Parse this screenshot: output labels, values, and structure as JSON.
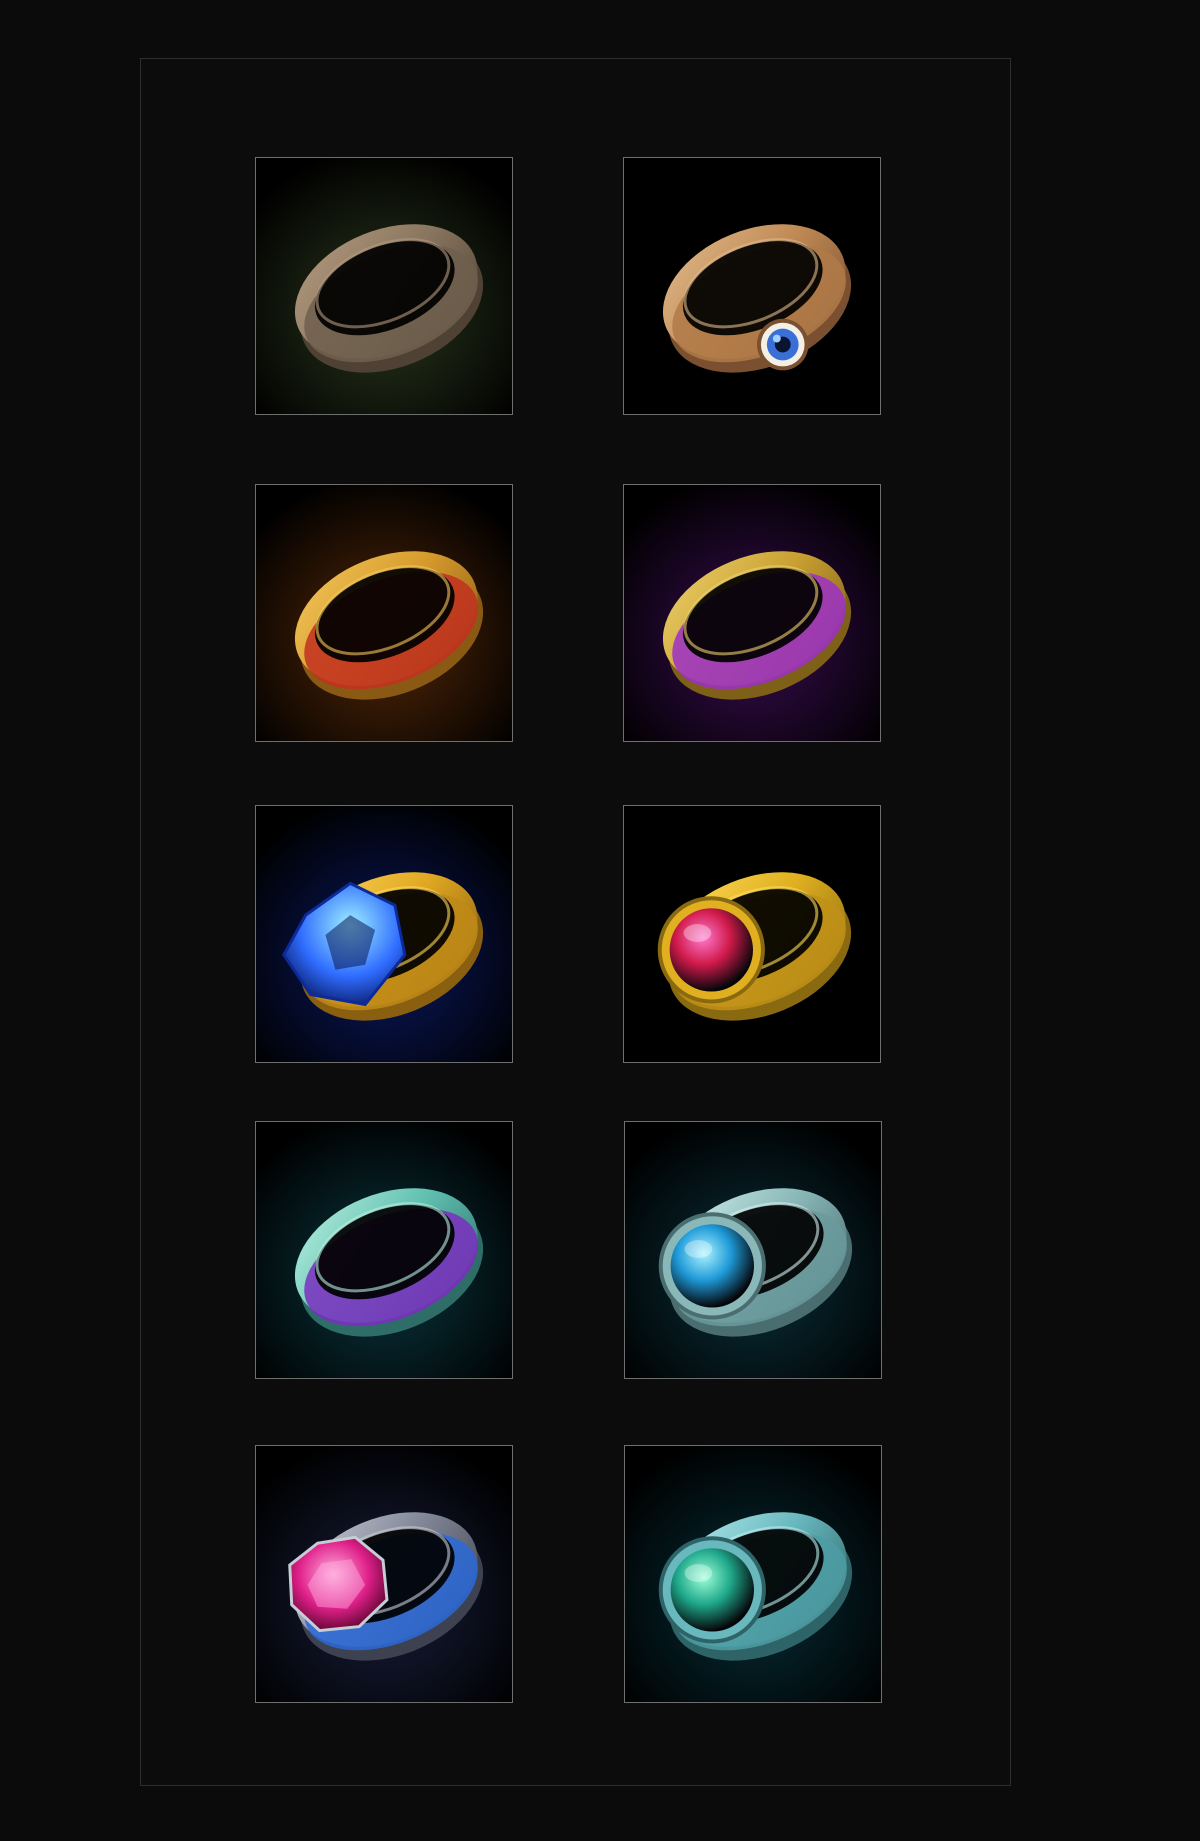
{
  "inventory": {
    "rings": [
      {
        "name": "bronze-plain-ring-icon",
        "band": "#8a7660",
        "band_light": "#b39a7e",
        "band_dark": "#4f4235",
        "inlay": "#6e5f4d",
        "glow": "#2c3a1e",
        "gem": null
      },
      {
        "name": "eye-gem-ring-icon",
        "band": "#c08a55",
        "band_light": "#e0b98a",
        "band_dark": "#7a5030",
        "inlay": "#b07a48",
        "glow": "#000000",
        "gem": {
          "type": "eye",
          "color": "#3a6fd8",
          "light": "#9fd0ff"
        }
      },
      {
        "name": "gold-red-inlay-ring-icon",
        "band": "#d69a2c",
        "band_light": "#f3c65a",
        "band_dark": "#8a5a14",
        "inlay": "#c2301e",
        "glow": "#5a2a08",
        "gem": null
      },
      {
        "name": "gold-purple-inlay-ring-icon",
        "band": "#c9a032",
        "band_light": "#ecd06a",
        "band_dark": "#7e6018",
        "inlay": "#9c2fc8",
        "glow": "#3d0d55",
        "gem": null
      },
      {
        "name": "blue-crystal-ring-icon",
        "band": "#e0a822",
        "band_light": "#ffd75a",
        "band_dark": "#8a6010",
        "inlay": "#c08a18",
        "glow": "#0a1a66",
        "gem": {
          "type": "crystal",
          "color": "#2f6cff",
          "light": "#9ff0ff"
        }
      },
      {
        "name": "ruby-orb-ring-icon",
        "band": "#e0b020",
        "band_light": "#ffdc5a",
        "band_dark": "#8a6a10",
        "inlay": "#c09018",
        "glow": "#000000",
        "gem": {
          "type": "orb",
          "color": "#d01a4a",
          "light": "#ff7ad0"
        }
      },
      {
        "name": "teal-purple-inlay-ring-icon",
        "band": "#5fbfb0",
        "band_light": "#b8f0e0",
        "band_dark": "#2f6e68",
        "inlay": "#7a2fc0",
        "glow": "#0a3a44",
        "gem": null
      },
      {
        "name": "silver-aqua-gem-ring-icon",
        "band": "#8ab8b8",
        "band_light": "#d2f0ee",
        "band_dark": "#4a6e70",
        "inlay": "#6a9a9c",
        "glow": "#0a3440",
        "gem": {
          "type": "orb",
          "color": "#1f9ad8",
          "light": "#aef4ff"
        }
      },
      {
        "name": "silver-pink-diamond-ring-icon",
        "band": "#7e8494",
        "band_light": "#c8ccd6",
        "band_dark": "#3e4250",
        "inlay": "#2a6ad8",
        "glow": "#1a2040",
        "gem": {
          "type": "diamond",
          "color": "#e0208a",
          "light": "#ffb0e0"
        }
      },
      {
        "name": "teal-green-orb-ring-icon",
        "band": "#68b8be",
        "band_light": "#b8eef0",
        "band_dark": "#2e6468",
        "inlay": "#4e9ea4",
        "glow": "#06303a",
        "gem": {
          "type": "orb",
          "color": "#1fa88a",
          "light": "#9effd8"
        }
      }
    ]
  }
}
